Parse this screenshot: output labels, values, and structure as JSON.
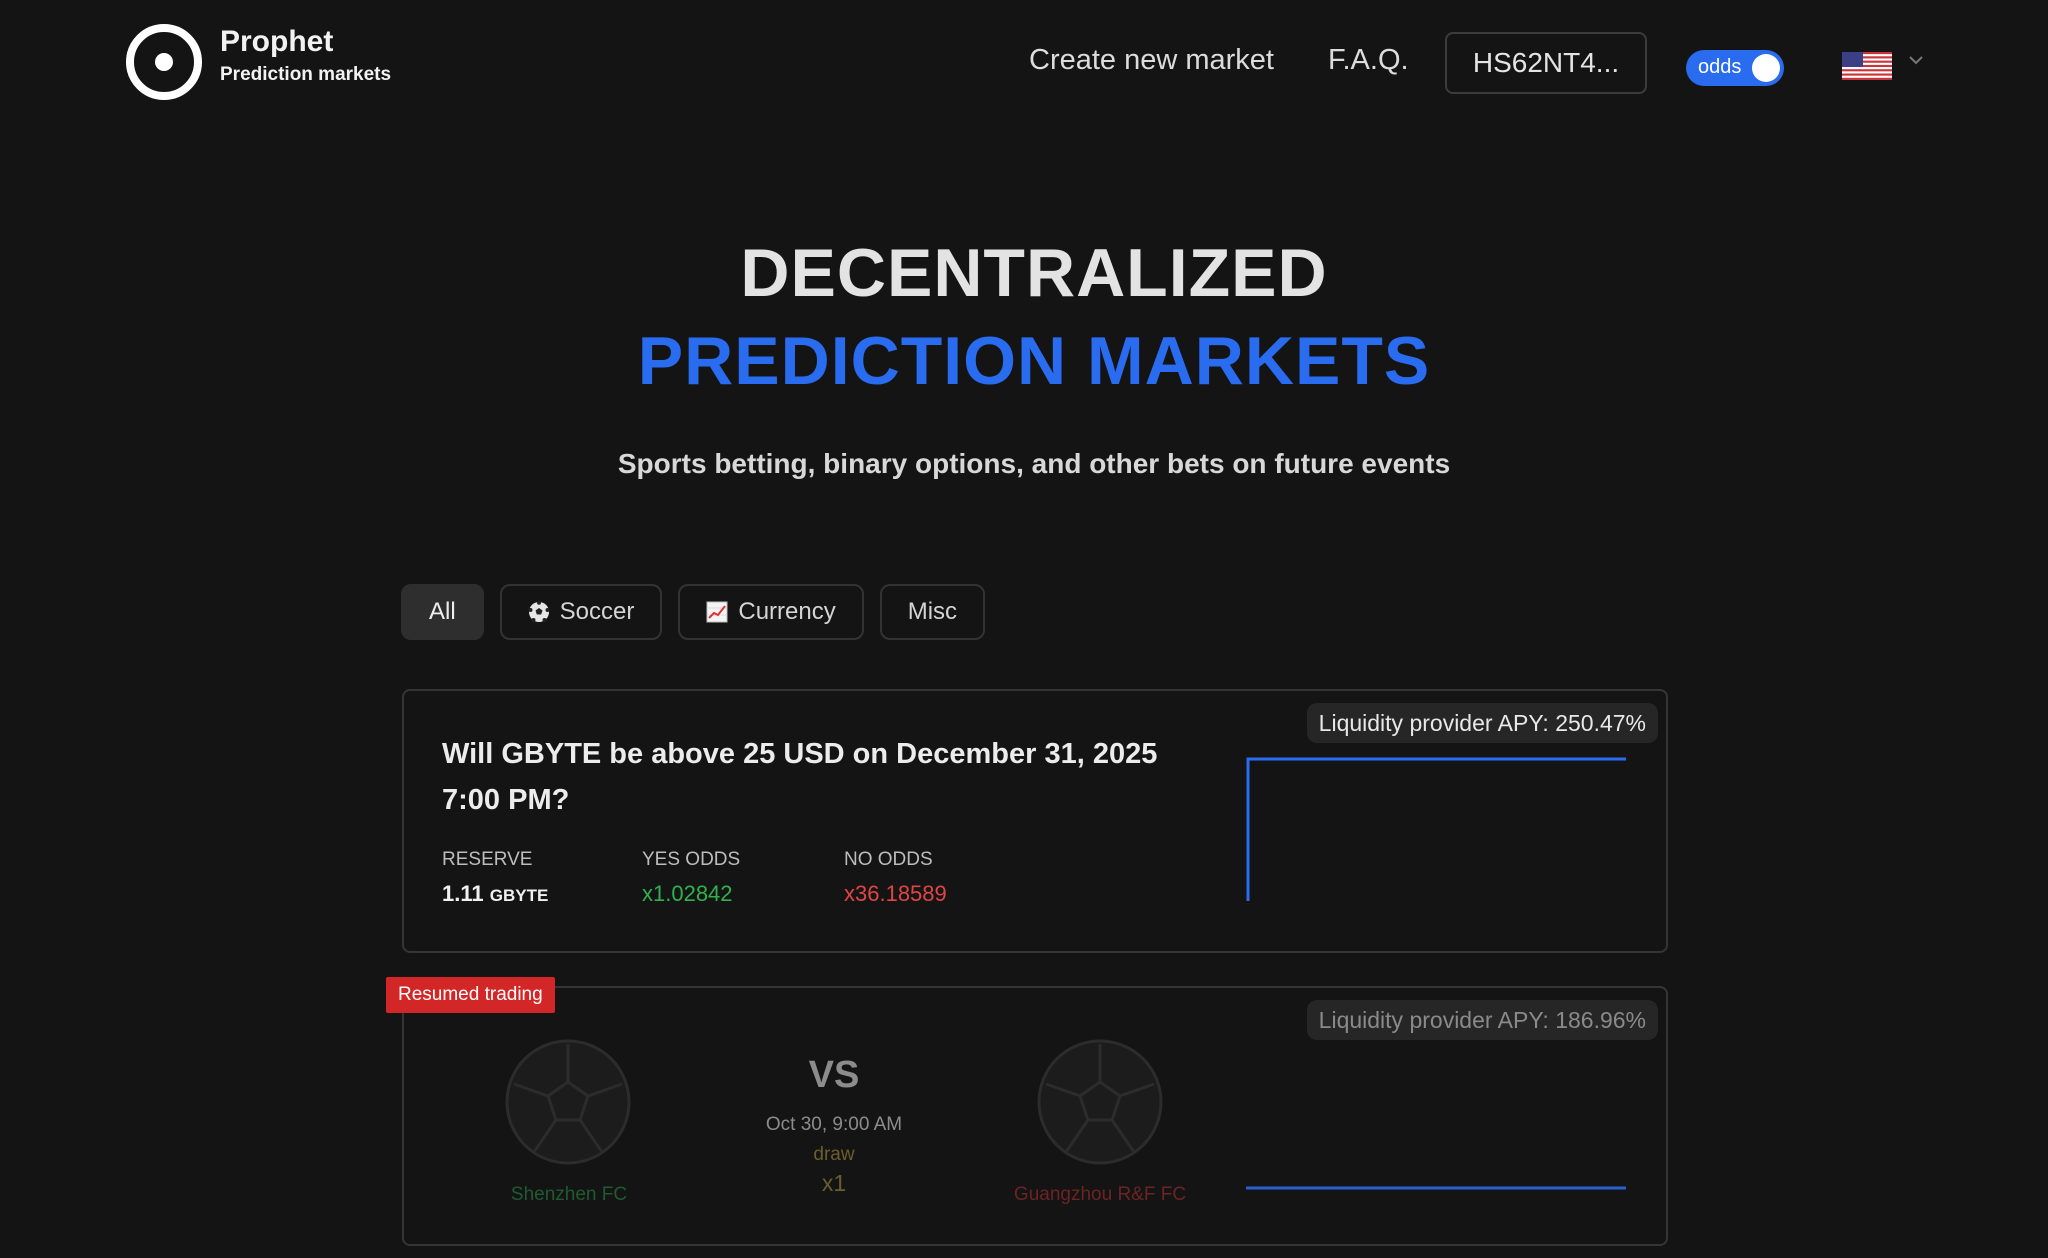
{
  "header": {
    "brand_title": "Prophet",
    "brand_subtitle": "Prediction markets",
    "nav_create": "Create new market",
    "nav_faq": "F.A.Q.",
    "address": "HS62NT4...",
    "toggle_label": "odds",
    "toggle_on": true,
    "language_flag": "us-flag-icon"
  },
  "hero": {
    "title_line1": "DECENTRALIZED",
    "title_line2": "PREDICTION MARKETS",
    "subtitle": "Sports betting, binary options, and other bets on future events"
  },
  "filters": [
    {
      "label": "All",
      "icon": null,
      "active": true
    },
    {
      "label": "Soccer",
      "icon": "soccer-ball-icon",
      "active": false
    },
    {
      "label": "Currency",
      "icon": "chart-up-icon",
      "active": false
    },
    {
      "label": "Misc",
      "icon": null,
      "active": false
    }
  ],
  "markets": [
    {
      "apy": "Liquidity provider APY: 250.47%",
      "question": "Will GBYTE be above 25 USD on December 31, 2025 7:00 PM?",
      "reserve_label": "RESERVE",
      "reserve_value": "1.11",
      "reserve_unit": "GBYTE",
      "yes_label": "YES ODDS",
      "yes_value": "x1.02842",
      "no_label": "NO ODDS",
      "no_value": "x36.18589"
    },
    {
      "badge": "Resumed trading",
      "apy": "Liquidity provider APY: 186.96%",
      "vs": "VS",
      "time": "Oct 30, 9:00 AM",
      "draw_label": "draw",
      "draw_odds": "x1",
      "home_team": "Shenzhen FC",
      "away_team": "Guangzhou R&F FC"
    }
  ],
  "colors": {
    "accent": "#2a6cf0",
    "background": "#141414",
    "yes": "#2fb14d",
    "no": "#e04545",
    "badge": "#d32626"
  }
}
